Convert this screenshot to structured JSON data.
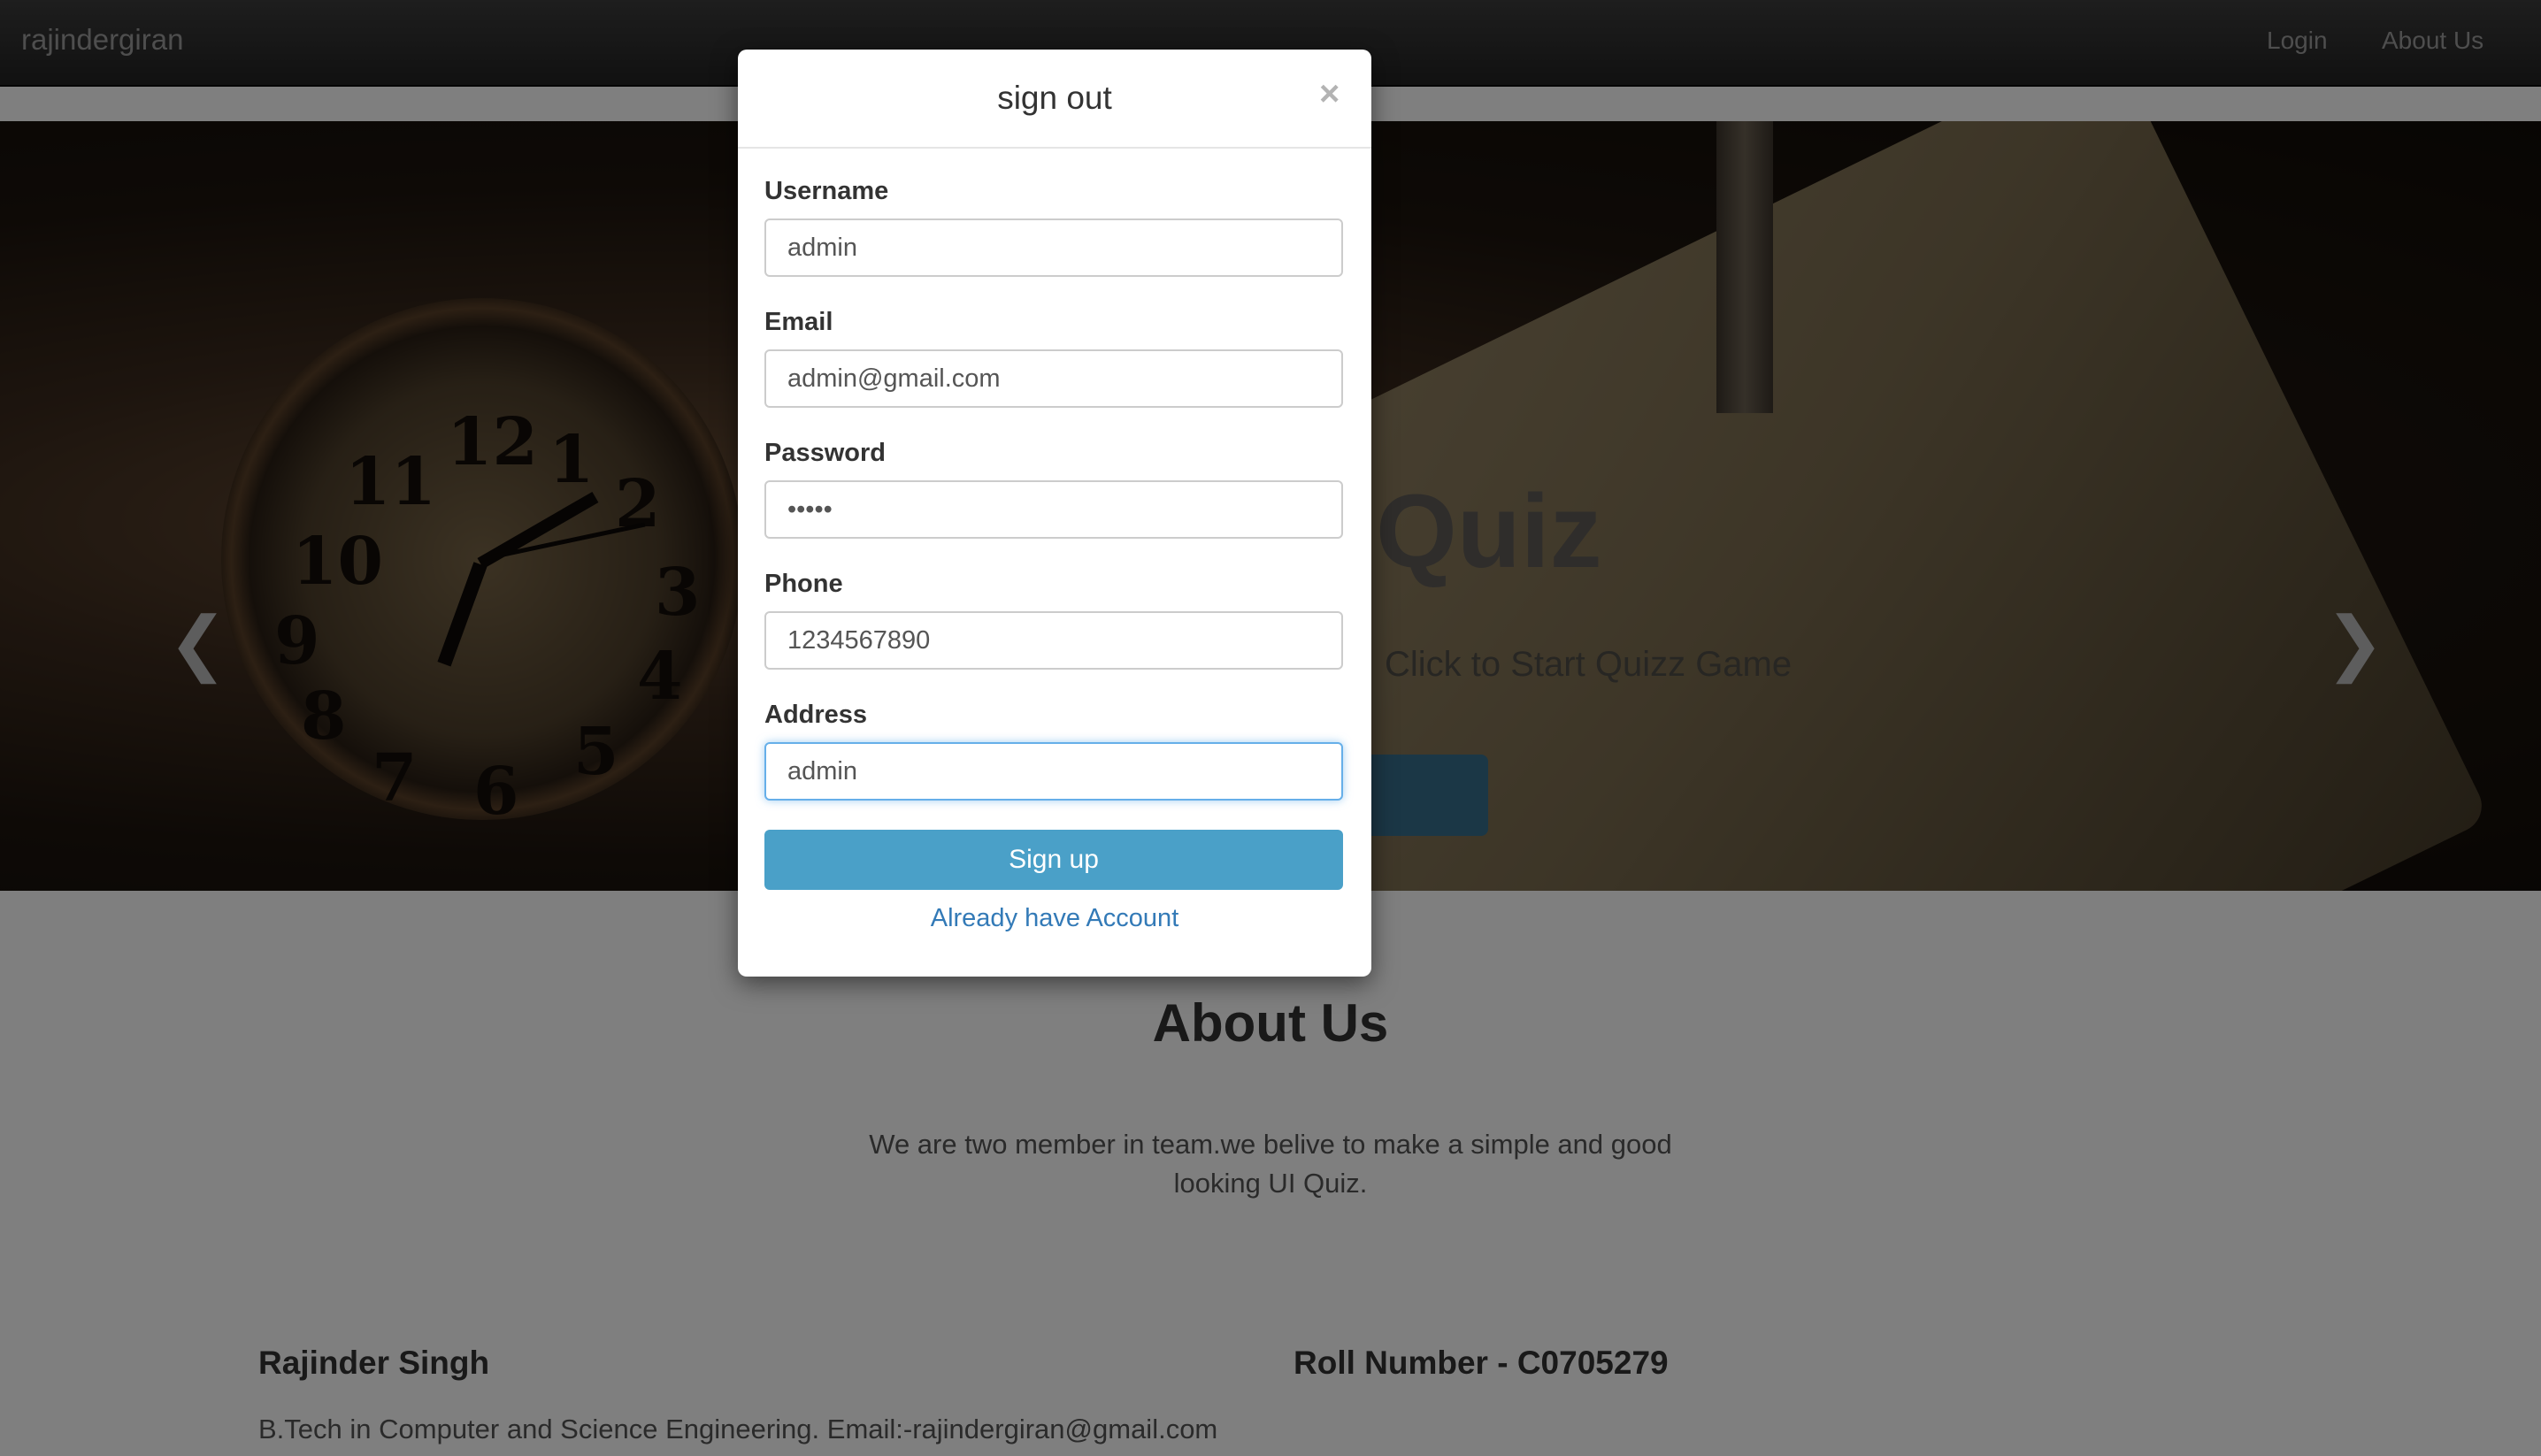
{
  "navbar": {
    "brand": "rajindergiran",
    "links": [
      {
        "label": "Login"
      },
      {
        "label": "About Us"
      }
    ]
  },
  "hero": {
    "title": "Quiz",
    "subtitle": "Click to Start Quizz Game"
  },
  "about": {
    "title": "About Us",
    "text": "We are two member in team.we belive to make a simple and good looking UI Quiz.",
    "member": {
      "name": "Rajinder Singh",
      "roll": "Roll Number - C0705279",
      "description": "B.Tech in Computer and Science Engineering. Email:-rajindergiran@gmail.com"
    }
  },
  "modal": {
    "title": "sign out",
    "close_glyph": "×",
    "fields": [
      {
        "label": "Username",
        "value": "admin"
      },
      {
        "label": "Email",
        "value": "admin@gmail.com"
      },
      {
        "label": "Password",
        "value": "•••••"
      },
      {
        "label": "Phone",
        "value": "1234567890"
      },
      {
        "label": "Address",
        "value": "admin"
      }
    ],
    "submit_label": "Sign up",
    "alt_link": "Already have Account"
  },
  "colors": {
    "navbar": "#222222",
    "primary_button": "#4aa0c8",
    "link": "#337ab7",
    "focus_border": "#66afe9"
  },
  "icons": {
    "prev": "chevron-left-icon",
    "next": "chevron-right-icon",
    "close": "close-icon"
  }
}
